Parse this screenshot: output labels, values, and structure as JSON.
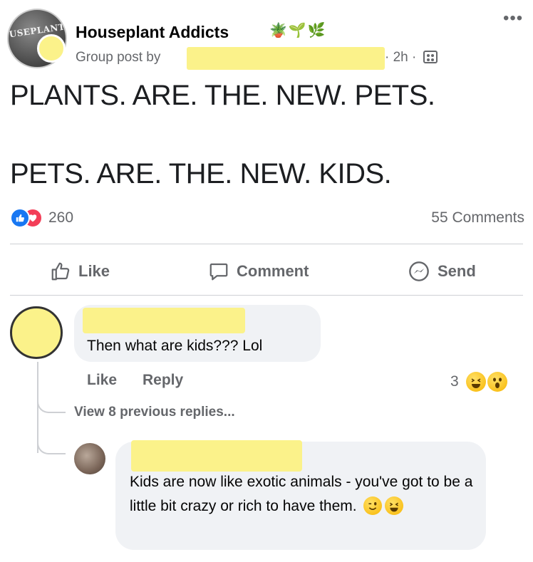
{
  "post": {
    "group_name": "Houseplant Addicts",
    "group_emojis": "🪴🌱🌿",
    "avatar_logo_text": "USEPLANT",
    "group_post_by": "Group post by",
    "time": "· 2h ·",
    "more_glyph": "•••",
    "line1": "PLANTS. ARE. THE. NEW. PETS.",
    "line2": "PETS. ARE. THE. NEW. KIDS.",
    "reaction_count": "260",
    "comments_count": "55 Comments"
  },
  "actions": {
    "like": "Like",
    "comment": "Comment",
    "send": "Send"
  },
  "comments": [
    {
      "text": "Then what are kids??? Lol",
      "like": "Like",
      "reply": "Reply",
      "reaction_count": "3"
    }
  ],
  "thread": {
    "view_previous": "View 8 previous replies..."
  },
  "reply": {
    "text": "Kids are now like exotic animals - you've got to be a little bit crazy or rich to have them."
  },
  "colors": {
    "like_blue": "#1877f2",
    "love_red": "#f33e58",
    "redaction_yellow": "#fbf28a",
    "bubble_gray": "#f0f2f5",
    "muted_text": "#65676b"
  }
}
